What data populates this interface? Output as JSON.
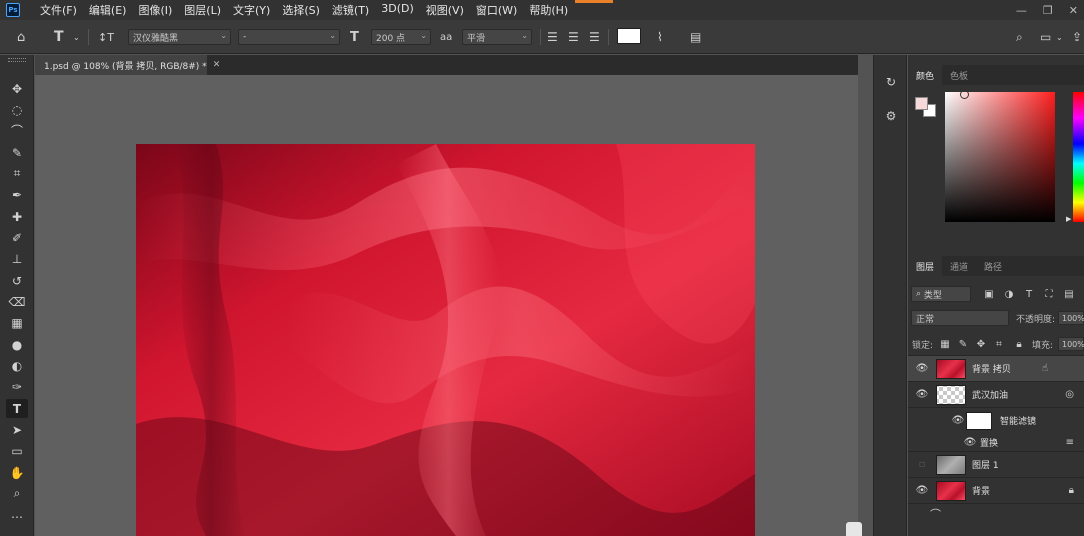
{
  "app": {
    "logo_text": "Ps"
  },
  "menu": {
    "items": [
      "文件(F)",
      "编辑(E)",
      "图像(I)",
      "图层(L)",
      "文字(Y)",
      "选择(S)",
      "滤镜(T)",
      "3D(D)",
      "视图(V)",
      "窗口(W)",
      "帮助(H)"
    ]
  },
  "window_controls": {
    "minimize": "—",
    "restore": "❐",
    "close": "✕"
  },
  "options": {
    "tool_icon": "T",
    "font_family": "汉仪雅酷黑",
    "font_style": "-",
    "font_size": "200 点",
    "aa_label": "aa",
    "antialias": "平滑",
    "text_color": "#ffffff"
  },
  "document": {
    "tab_title": "1.psd @ 108% (背景 拷贝, RGB/8#) *",
    "close": "✕"
  },
  "color_panel": {
    "tabs": [
      "颜色",
      "色板"
    ],
    "active_tab": 0,
    "foreground": "#f8d9d9",
    "background": "#ffffff"
  },
  "layers_panel": {
    "tabs": [
      "图层",
      "通道",
      "路径"
    ],
    "active_tab": 0,
    "filter_kind": "类型",
    "blend_mode": "正常",
    "opacity_label": "不透明度:",
    "opacity_value": "100%",
    "lock_label": "锁定:",
    "fill_label": "填充:",
    "fill_value": "100%",
    "layers": [
      {
        "name": "背景 拷贝",
        "visible": true,
        "thumb": "red",
        "selected": true
      },
      {
        "name": "武汉加油",
        "visible": true,
        "thumb": "check",
        "selected": false
      },
      {
        "name": "智能滤镜",
        "visible": true,
        "thumb": "white",
        "selected": false
      },
      {
        "name": "置换",
        "visible": true,
        "thumb": "none",
        "selected": false
      },
      {
        "name": "图层 1",
        "visible": false,
        "thumb": "gray",
        "selected": false
      },
      {
        "name": "背景",
        "visible": true,
        "thumb": "red",
        "selected": false
      }
    ]
  }
}
